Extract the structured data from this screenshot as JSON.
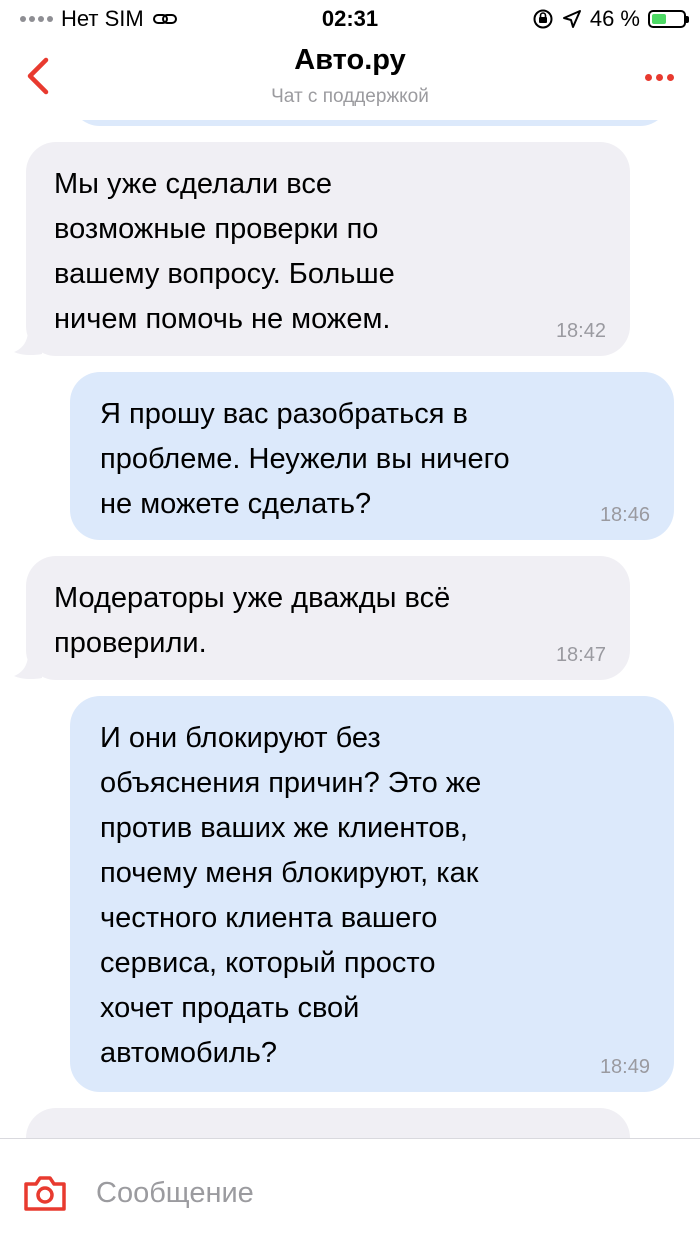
{
  "status_bar": {
    "carrier": "Нет SIM",
    "time": "02:31",
    "battery_percent": "46 %",
    "battery_level": 0.46
  },
  "header": {
    "title": "Авто.ру",
    "subtitle": "Чат с поддержкой"
  },
  "messages": [
    {
      "direction": "incoming",
      "text": "Мы уже сделали все\nвозможные проверки по\nвашему вопросу. Больше\nничем помочь не можем.",
      "time": "18:42"
    },
    {
      "direction": "outgoing",
      "text": "Я прошу вас разобраться в\nпроблеме. Неужели вы ничего\nне можете сделать?",
      "time": "18:46"
    },
    {
      "direction": "incoming",
      "text": "Модераторы уже дважды всё\nпроверили.",
      "time": "18:47"
    },
    {
      "direction": "outgoing",
      "text": "И они блокируют без\nобъяснения причин? Это же\nпротив ваших же клиентов,\nпочему меня блокируют, как\nчестного клиента вашего\nсервиса, который просто\nхочет продать свой\nавтомобиль?",
      "time": "18:49"
    }
  ],
  "composer": {
    "placeholder": "Сообщение"
  },
  "colors": {
    "accent": "#e83a2f",
    "incoming_bubble": "#f0eff4",
    "outgoing_bubble": "#dce9fb"
  },
  "icons": {
    "back": "chevron-left-icon",
    "more": "more-dots-icon",
    "camera": "camera-icon"
  }
}
